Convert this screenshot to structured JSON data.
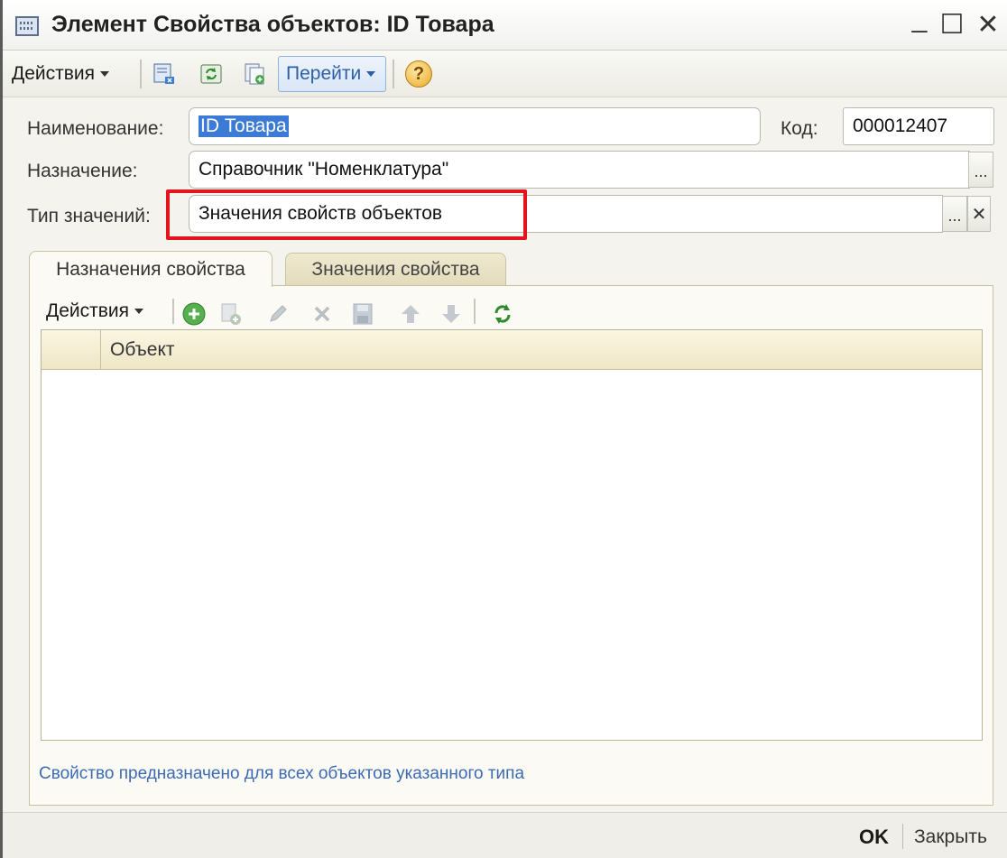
{
  "window": {
    "title": "Элемент Свойства объектов: ID Товара",
    "controls": {
      "minimize": "_",
      "maximize": "☐",
      "close": "✕"
    }
  },
  "toolbar": {
    "actions_label": "Действия",
    "goto_label": "Перейти",
    "help": "?"
  },
  "form": {
    "name_label": "Наименование:",
    "name_value": "ID Товара",
    "code_label": "Код:",
    "code_value": "000012407",
    "purpose_label": "Назначение:",
    "purpose_value": "Справочник \"Номенклатура\"",
    "value_type_label": "Тип значений:",
    "value_type_value": "Значения свойств объектов",
    "select_button": "...",
    "clear_button": "✕"
  },
  "tabs": [
    {
      "label": "Назначения свойства",
      "active": true
    },
    {
      "label": "Значения свойства",
      "active": false
    }
  ],
  "tab_toolbar": {
    "actions_label": "Действия"
  },
  "grid": {
    "columns": [
      "Объект"
    ],
    "rows": []
  },
  "note": "Свойство предназначено для всех объектов указанного типа",
  "footer": {
    "ok_label": "OK",
    "close_label": "Закрыть"
  },
  "colors": {
    "highlight": "#e3141b",
    "link_text": "#3c6bb4",
    "selection": "#3b7bd6"
  }
}
